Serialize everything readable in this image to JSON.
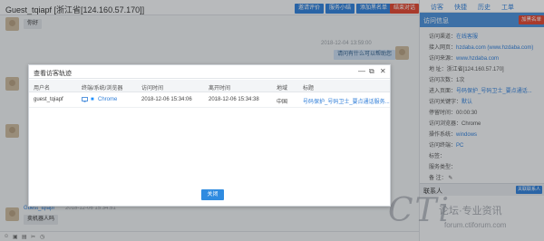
{
  "chat": {
    "visitor_name": "Guest_tqiapf [浙江省[124.160.57.170]]",
    "header_buttons": [
      "邀请评价",
      "服务小结",
      "添加黑名单",
      "结束对话"
    ],
    "messages": [
      {
        "from": "visitor",
        "text": "你好"
      },
      {
        "from": "agent",
        "time": "2018-12-04 13:59:00",
        "text": "请问有什么可以帮助您"
      },
      {
        "from": "visitor",
        "name": "Guest_tqiapf",
        "time": "2018-12-06 15:34:51",
        "text": "卖机器人吗"
      }
    ],
    "toolbar_icons": [
      "smiley-icon",
      "image-icon",
      "folder-icon",
      "screenshot-icon",
      "history-icon"
    ]
  },
  "right_panel": {
    "tabs": [
      "访客",
      "快捷",
      "历史",
      "工单"
    ],
    "info_title": "访问信息",
    "block_button": "加黑名单",
    "rows": [
      {
        "label": "访问渠道：",
        "value": "在线客服"
      },
      {
        "label": "接入网页：",
        "value": "hzdaba.com (www.hzdaba.com)"
      },
      {
        "label": "访问来源：",
        "value": "www.hzdaba.com"
      },
      {
        "label": "地 址：",
        "value": "浙江省[124.160.57.170]"
      },
      {
        "label": "访问次数：",
        "value": "1次"
      },
      {
        "label": "进入页面：",
        "value": "号码保护_号码卫士_要点通话..."
      },
      {
        "label": "访问关键字：",
        "value": "默认"
      },
      {
        "label": "停留时间：",
        "value": "00:00:30"
      },
      {
        "label": "访问浏览器：",
        "value": "Chrome"
      },
      {
        "label": "操作系统：",
        "value": "windows"
      },
      {
        "label": "访问终端：",
        "value": "PC"
      },
      {
        "label": "标签：",
        "value": ""
      },
      {
        "label": "服务类型：",
        "value": ""
      },
      {
        "label": "备 注：",
        "value": ""
      }
    ],
    "contact_title": "联系人",
    "contact_button": "关联联系人"
  },
  "watermark": {
    "brand": "CTi",
    "text": "论坛·专业资讯",
    "url": "forum.ctiforum.com"
  },
  "modal": {
    "title": "查看访客轨迹",
    "columns": [
      "用户名",
      "终端/系统/浏览器",
      "访问时间",
      "离开时间",
      "地域",
      "标题"
    ],
    "rows": [
      {
        "user": "guest_tqiapf",
        "browser": "Chrome",
        "visit_time": "2018-12-06 15:34:06",
        "leave_time": "2018-12-06 15:34:38",
        "region": "中国",
        "title": "号码保护_号码卫士_要点通话服务..."
      }
    ],
    "close_label": "关闭"
  },
  "colors": {
    "accent": "#2f7ed8",
    "danger": "#e0452f",
    "panel_head": "#4a8fd8"
  }
}
